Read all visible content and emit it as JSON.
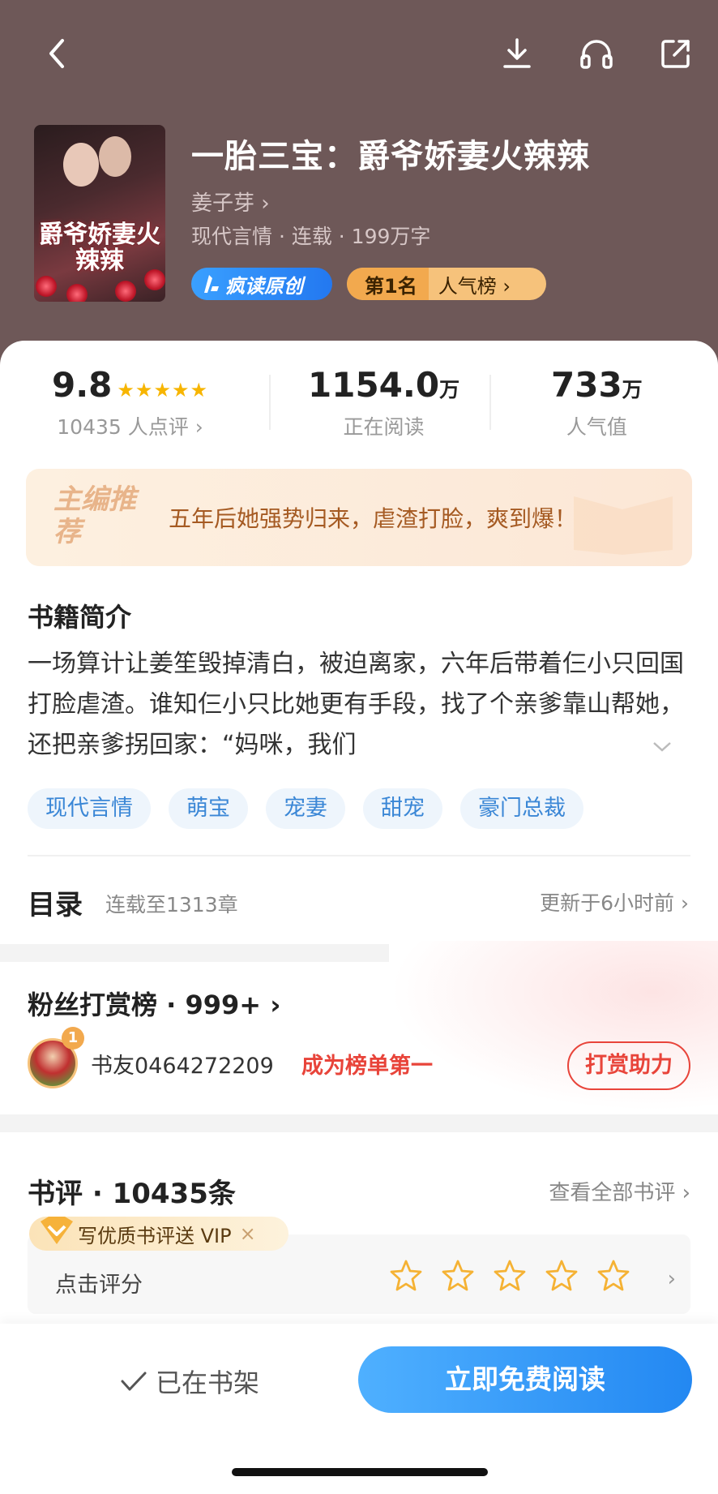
{
  "book": {
    "title": "一胎三宝：爵爷娇妻火辣辣",
    "author": "姜子芽 ›",
    "meta": "现代言情 · 连载 · 199万字",
    "cover_title": "爵爷娇妻火辣辣",
    "badge_original": "疯读原创",
    "rank_pos": "第1名",
    "rank_list": "人气榜 ›"
  },
  "stats": {
    "score": "9.8",
    "stars": "★★★★★",
    "score_label": "10435 人点评 ›",
    "reading_value": "1154.0",
    "reading_unit": "万",
    "reading_label": "正在阅读",
    "popularity_value": "733",
    "popularity_unit": "万",
    "popularity_label": "人气值"
  },
  "editor_rec": {
    "tag": "主编推荐",
    "text": "五年后她强势归来，虐渣打脸，爽到爆！"
  },
  "intro": {
    "title": "书籍简介",
    "text": "一场算计让姜笙毁掉清白，被迫离家，六年后带着仨小只回国打脸虐渣。谁知仨小只比她更有手段，找了个亲爹靠山帮她，还把亲爹拐回家：“妈咪，我们",
    "tags": [
      "现代言情",
      "萌宝",
      "宠妻",
      "甜宠",
      "豪门总裁"
    ]
  },
  "toc": {
    "title": "目录",
    "status": "连载至1313章",
    "updated": "更新于6小时前 ›"
  },
  "fans": {
    "title": "粉丝打赏榜 · 999+ ›",
    "rank_badge": "1",
    "user": "书友0464272209",
    "cta": "成为榜单第一",
    "button": "打赏助力"
  },
  "reviews": {
    "title": "书评 · 10435条",
    "view_all": "查看全部书评 ›",
    "vip_promo": "写优质书评送 VIP",
    "vip_close": "×",
    "rate_label": "点击评分",
    "rate_arrow": "›"
  },
  "bottom": {
    "shelf": "已在书架",
    "read": "立即免费阅读"
  },
  "colors": {
    "header_bg": "#6e5858",
    "accent_blue": "#2388f2",
    "star": "#f7b500",
    "cta_red": "#e8443a"
  }
}
